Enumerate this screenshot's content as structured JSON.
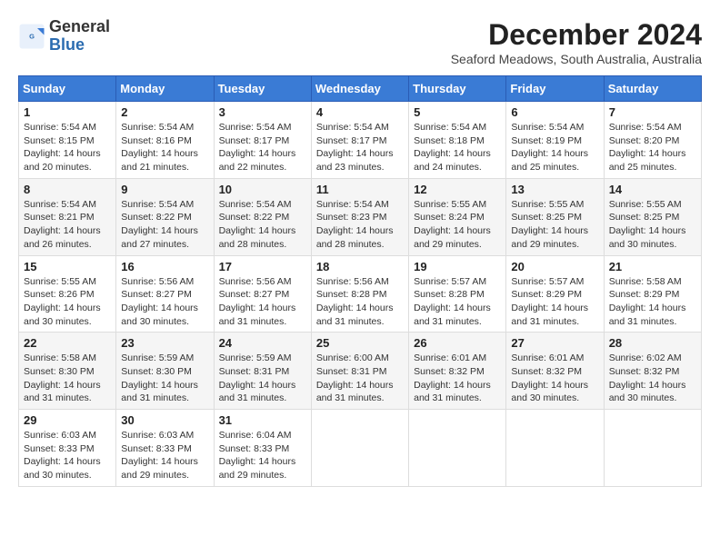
{
  "logo": {
    "line1": "General",
    "line2": "Blue"
  },
  "title": "December 2024",
  "location": "Seaford Meadows, South Australia, Australia",
  "weekdays": [
    "Sunday",
    "Monday",
    "Tuesday",
    "Wednesday",
    "Thursday",
    "Friday",
    "Saturday"
  ],
  "weeks": [
    [
      {
        "day": "1",
        "info": "Sunrise: 5:54 AM\nSunset: 8:15 PM\nDaylight: 14 hours\nand 20 minutes."
      },
      {
        "day": "2",
        "info": "Sunrise: 5:54 AM\nSunset: 8:16 PM\nDaylight: 14 hours\nand 21 minutes."
      },
      {
        "day": "3",
        "info": "Sunrise: 5:54 AM\nSunset: 8:17 PM\nDaylight: 14 hours\nand 22 minutes."
      },
      {
        "day": "4",
        "info": "Sunrise: 5:54 AM\nSunset: 8:17 PM\nDaylight: 14 hours\nand 23 minutes."
      },
      {
        "day": "5",
        "info": "Sunrise: 5:54 AM\nSunset: 8:18 PM\nDaylight: 14 hours\nand 24 minutes."
      },
      {
        "day": "6",
        "info": "Sunrise: 5:54 AM\nSunset: 8:19 PM\nDaylight: 14 hours\nand 25 minutes."
      },
      {
        "day": "7",
        "info": "Sunrise: 5:54 AM\nSunset: 8:20 PM\nDaylight: 14 hours\nand 25 minutes."
      }
    ],
    [
      {
        "day": "8",
        "info": "Sunrise: 5:54 AM\nSunset: 8:21 PM\nDaylight: 14 hours\nand 26 minutes."
      },
      {
        "day": "9",
        "info": "Sunrise: 5:54 AM\nSunset: 8:22 PM\nDaylight: 14 hours\nand 27 minutes."
      },
      {
        "day": "10",
        "info": "Sunrise: 5:54 AM\nSunset: 8:22 PM\nDaylight: 14 hours\nand 28 minutes."
      },
      {
        "day": "11",
        "info": "Sunrise: 5:54 AM\nSunset: 8:23 PM\nDaylight: 14 hours\nand 28 minutes."
      },
      {
        "day": "12",
        "info": "Sunrise: 5:55 AM\nSunset: 8:24 PM\nDaylight: 14 hours\nand 29 minutes."
      },
      {
        "day": "13",
        "info": "Sunrise: 5:55 AM\nSunset: 8:25 PM\nDaylight: 14 hours\nand 29 minutes."
      },
      {
        "day": "14",
        "info": "Sunrise: 5:55 AM\nSunset: 8:25 PM\nDaylight: 14 hours\nand 30 minutes."
      }
    ],
    [
      {
        "day": "15",
        "info": "Sunrise: 5:55 AM\nSunset: 8:26 PM\nDaylight: 14 hours\nand 30 minutes."
      },
      {
        "day": "16",
        "info": "Sunrise: 5:56 AM\nSunset: 8:27 PM\nDaylight: 14 hours\nand 30 minutes."
      },
      {
        "day": "17",
        "info": "Sunrise: 5:56 AM\nSunset: 8:27 PM\nDaylight: 14 hours\nand 31 minutes."
      },
      {
        "day": "18",
        "info": "Sunrise: 5:56 AM\nSunset: 8:28 PM\nDaylight: 14 hours\nand 31 minutes."
      },
      {
        "day": "19",
        "info": "Sunrise: 5:57 AM\nSunset: 8:28 PM\nDaylight: 14 hours\nand 31 minutes."
      },
      {
        "day": "20",
        "info": "Sunrise: 5:57 AM\nSunset: 8:29 PM\nDaylight: 14 hours\nand 31 minutes."
      },
      {
        "day": "21",
        "info": "Sunrise: 5:58 AM\nSunset: 8:29 PM\nDaylight: 14 hours\nand 31 minutes."
      }
    ],
    [
      {
        "day": "22",
        "info": "Sunrise: 5:58 AM\nSunset: 8:30 PM\nDaylight: 14 hours\nand 31 minutes."
      },
      {
        "day": "23",
        "info": "Sunrise: 5:59 AM\nSunset: 8:30 PM\nDaylight: 14 hours\nand 31 minutes."
      },
      {
        "day": "24",
        "info": "Sunrise: 5:59 AM\nSunset: 8:31 PM\nDaylight: 14 hours\nand 31 minutes."
      },
      {
        "day": "25",
        "info": "Sunrise: 6:00 AM\nSunset: 8:31 PM\nDaylight: 14 hours\nand 31 minutes."
      },
      {
        "day": "26",
        "info": "Sunrise: 6:01 AM\nSunset: 8:32 PM\nDaylight: 14 hours\nand 31 minutes."
      },
      {
        "day": "27",
        "info": "Sunrise: 6:01 AM\nSunset: 8:32 PM\nDaylight: 14 hours\nand 30 minutes."
      },
      {
        "day": "28",
        "info": "Sunrise: 6:02 AM\nSunset: 8:32 PM\nDaylight: 14 hours\nand 30 minutes."
      }
    ],
    [
      {
        "day": "29",
        "info": "Sunrise: 6:03 AM\nSunset: 8:33 PM\nDaylight: 14 hours\nand 30 minutes."
      },
      {
        "day": "30",
        "info": "Sunrise: 6:03 AM\nSunset: 8:33 PM\nDaylight: 14 hours\nand 29 minutes."
      },
      {
        "day": "31",
        "info": "Sunrise: 6:04 AM\nSunset: 8:33 PM\nDaylight: 14 hours\nand 29 minutes."
      },
      {
        "day": "",
        "info": ""
      },
      {
        "day": "",
        "info": ""
      },
      {
        "day": "",
        "info": ""
      },
      {
        "day": "",
        "info": ""
      }
    ]
  ]
}
